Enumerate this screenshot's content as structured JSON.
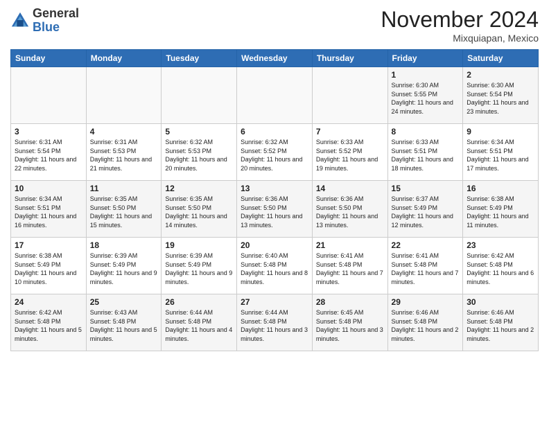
{
  "logo": {
    "general": "General",
    "blue": "Blue"
  },
  "header": {
    "month": "November 2024",
    "location": "Mixquiapan, Mexico"
  },
  "weekdays": [
    "Sunday",
    "Monday",
    "Tuesday",
    "Wednesday",
    "Thursday",
    "Friday",
    "Saturday"
  ],
  "weeks": [
    [
      {
        "day": "",
        "info": ""
      },
      {
        "day": "",
        "info": ""
      },
      {
        "day": "",
        "info": ""
      },
      {
        "day": "",
        "info": ""
      },
      {
        "day": "",
        "info": ""
      },
      {
        "day": "1",
        "info": "Sunrise: 6:30 AM\nSunset: 5:55 PM\nDaylight: 11 hours and 24 minutes."
      },
      {
        "day": "2",
        "info": "Sunrise: 6:30 AM\nSunset: 5:54 PM\nDaylight: 11 hours and 23 minutes."
      }
    ],
    [
      {
        "day": "3",
        "info": "Sunrise: 6:31 AM\nSunset: 5:54 PM\nDaylight: 11 hours and 22 minutes."
      },
      {
        "day": "4",
        "info": "Sunrise: 6:31 AM\nSunset: 5:53 PM\nDaylight: 11 hours and 21 minutes."
      },
      {
        "day": "5",
        "info": "Sunrise: 6:32 AM\nSunset: 5:53 PM\nDaylight: 11 hours and 20 minutes."
      },
      {
        "day": "6",
        "info": "Sunrise: 6:32 AM\nSunset: 5:52 PM\nDaylight: 11 hours and 20 minutes."
      },
      {
        "day": "7",
        "info": "Sunrise: 6:33 AM\nSunset: 5:52 PM\nDaylight: 11 hours and 19 minutes."
      },
      {
        "day": "8",
        "info": "Sunrise: 6:33 AM\nSunset: 5:51 PM\nDaylight: 11 hours and 18 minutes."
      },
      {
        "day": "9",
        "info": "Sunrise: 6:34 AM\nSunset: 5:51 PM\nDaylight: 11 hours and 17 minutes."
      }
    ],
    [
      {
        "day": "10",
        "info": "Sunrise: 6:34 AM\nSunset: 5:51 PM\nDaylight: 11 hours and 16 minutes."
      },
      {
        "day": "11",
        "info": "Sunrise: 6:35 AM\nSunset: 5:50 PM\nDaylight: 11 hours and 15 minutes."
      },
      {
        "day": "12",
        "info": "Sunrise: 6:35 AM\nSunset: 5:50 PM\nDaylight: 11 hours and 14 minutes."
      },
      {
        "day": "13",
        "info": "Sunrise: 6:36 AM\nSunset: 5:50 PM\nDaylight: 11 hours and 13 minutes."
      },
      {
        "day": "14",
        "info": "Sunrise: 6:36 AM\nSunset: 5:50 PM\nDaylight: 11 hours and 13 minutes."
      },
      {
        "day": "15",
        "info": "Sunrise: 6:37 AM\nSunset: 5:49 PM\nDaylight: 11 hours and 12 minutes."
      },
      {
        "day": "16",
        "info": "Sunrise: 6:38 AM\nSunset: 5:49 PM\nDaylight: 11 hours and 11 minutes."
      }
    ],
    [
      {
        "day": "17",
        "info": "Sunrise: 6:38 AM\nSunset: 5:49 PM\nDaylight: 11 hours and 10 minutes."
      },
      {
        "day": "18",
        "info": "Sunrise: 6:39 AM\nSunset: 5:49 PM\nDaylight: 11 hours and 9 minutes."
      },
      {
        "day": "19",
        "info": "Sunrise: 6:39 AM\nSunset: 5:49 PM\nDaylight: 11 hours and 9 minutes."
      },
      {
        "day": "20",
        "info": "Sunrise: 6:40 AM\nSunset: 5:48 PM\nDaylight: 11 hours and 8 minutes."
      },
      {
        "day": "21",
        "info": "Sunrise: 6:41 AM\nSunset: 5:48 PM\nDaylight: 11 hours and 7 minutes."
      },
      {
        "day": "22",
        "info": "Sunrise: 6:41 AM\nSunset: 5:48 PM\nDaylight: 11 hours and 7 minutes."
      },
      {
        "day": "23",
        "info": "Sunrise: 6:42 AM\nSunset: 5:48 PM\nDaylight: 11 hours and 6 minutes."
      }
    ],
    [
      {
        "day": "24",
        "info": "Sunrise: 6:42 AM\nSunset: 5:48 PM\nDaylight: 11 hours and 5 minutes."
      },
      {
        "day": "25",
        "info": "Sunrise: 6:43 AM\nSunset: 5:48 PM\nDaylight: 11 hours and 5 minutes."
      },
      {
        "day": "26",
        "info": "Sunrise: 6:44 AM\nSunset: 5:48 PM\nDaylight: 11 hours and 4 minutes."
      },
      {
        "day": "27",
        "info": "Sunrise: 6:44 AM\nSunset: 5:48 PM\nDaylight: 11 hours and 3 minutes."
      },
      {
        "day": "28",
        "info": "Sunrise: 6:45 AM\nSunset: 5:48 PM\nDaylight: 11 hours and 3 minutes."
      },
      {
        "day": "29",
        "info": "Sunrise: 6:46 AM\nSunset: 5:48 PM\nDaylight: 11 hours and 2 minutes."
      },
      {
        "day": "30",
        "info": "Sunrise: 6:46 AM\nSunset: 5:48 PM\nDaylight: 11 hours and 2 minutes."
      }
    ]
  ]
}
